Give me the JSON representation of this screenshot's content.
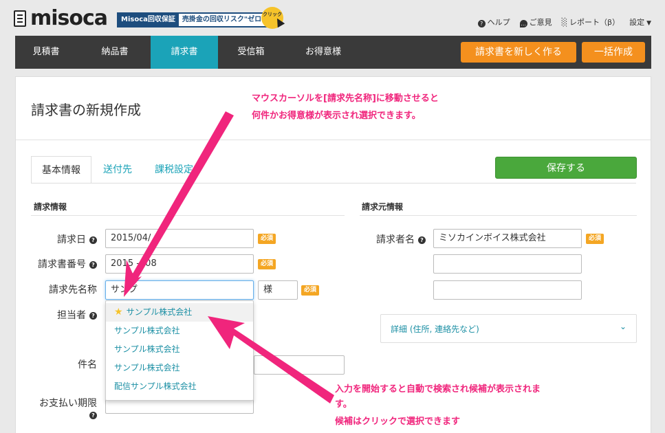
{
  "header": {
    "logo_text": "misoca",
    "banner_left": "Misoca回収保証",
    "banner_right": "売掛金の回収リスク\"ゼロ\"",
    "banner_badge": "クリック",
    "links": [
      {
        "icon": "help-icon",
        "label": "ヘルプ"
      },
      {
        "icon": "comment-icon",
        "label": "ご意見"
      },
      {
        "icon": "bar-chart-icon",
        "label": "レポート（β）"
      },
      {
        "icon": "caret-down-icon",
        "label": "設定"
      }
    ]
  },
  "nav": {
    "items": [
      "見積書",
      "納品書",
      "請求書",
      "受信箱",
      "お得意様"
    ],
    "active": "請求書",
    "create_button": "請求書を新しく作る",
    "batch_button": "一括作成"
  },
  "page": {
    "title": "請求書の新規作成",
    "tabs": [
      "基本情報",
      "送付先",
      "課税設定"
    ],
    "active_tab": "基本情報",
    "save_button": "保存する"
  },
  "billing_info": {
    "heading": "請求情報",
    "date_label": "請求日",
    "date_value": "2015/04/",
    "number_label": "請求書番号",
    "number_value": "2015 -008",
    "client_label": "請求先名称",
    "client_value": "サンプ",
    "honorific_value": "様",
    "staff_label": "担当者",
    "subject_label": "件名",
    "due_label": "お支払い期限",
    "required_badge": "必須"
  },
  "autocomplete": {
    "items": [
      "サンプル株式会社",
      "サンプル株式会社",
      "サンプル株式会社",
      "サンプル株式会社",
      "配信サンプル株式会社"
    ],
    "starred_index": 0
  },
  "issuer_info": {
    "heading": "請求元情報",
    "issuer_label": "請求者名",
    "issuer_value": "ミソカインボイス株式会社",
    "required_badge": "必須",
    "detail_label": "詳細 (住所, 連絡先など)",
    "detail_icon": "double-chevron-down-icon"
  },
  "annotations": {
    "top_line1": "マウスカーソルを[請求先名称]に移動させると",
    "top_line2": "何件かお得意様が表示され選択できます。",
    "bottom_line1": "入力を開始すると自動で検索され候補が表示されま",
    "bottom_line2": "す。",
    "bottom_line3": "候補はクリックで選択できます"
  },
  "colors": {
    "accent": "#1ba3b8",
    "orange": "#f4901e",
    "save_green": "#4aa83c",
    "annotation_pink": "#f0257c",
    "required": "#f4a623"
  }
}
